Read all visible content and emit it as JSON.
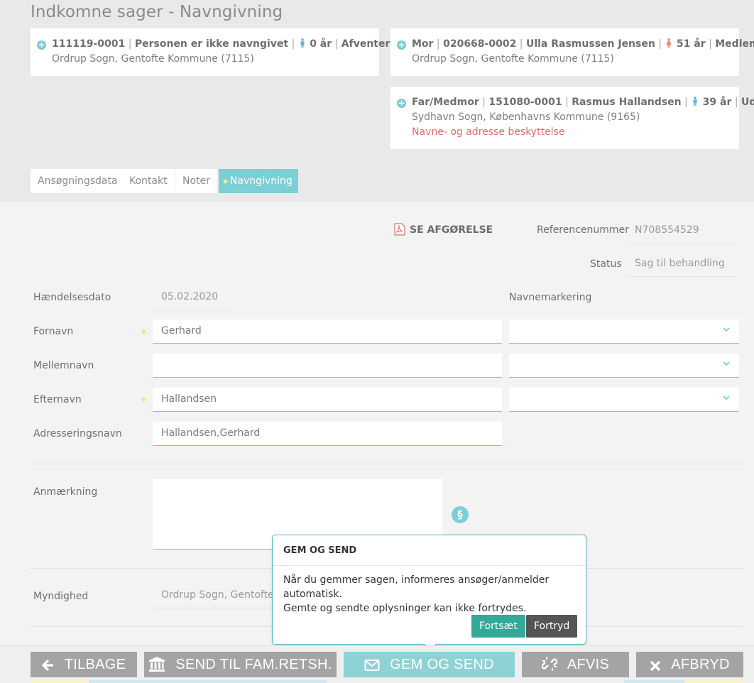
{
  "page": {
    "title": "Indkomne sager - Navngivning"
  },
  "cards": {
    "child": {
      "id": "111119-0001",
      "name": "Personen er ikke navngivet",
      "age": "0 år",
      "status": "Afventer",
      "location": "Ordrup Sogn, Gentofte Kommune (7115)"
    },
    "mother": {
      "role": "Mor",
      "id": "020668-0002",
      "name": "Ulla Rasmussen Jensen",
      "age": "51 år",
      "status": "Medlem",
      "location": "Ordrup Sogn, Gentofte Kommune (7115)"
    },
    "father": {
      "role": "Far/Medmor",
      "id": "151080-0001",
      "name": "Rasmus Hallandsen",
      "age": "39 år",
      "status": "Udenfor",
      "location": "Sydhavn Sogn, Københavns Kommune (9165)",
      "warning": "Navne- og adresse beskyttelse"
    }
  },
  "tabs": [
    {
      "label": "Ansøgningsdata"
    },
    {
      "label": "Kontakt"
    },
    {
      "label": "Noter"
    },
    {
      "label": "Navngivning"
    }
  ],
  "form": {
    "se_afgorelse": "SE AFGØRELSE",
    "referencenummer_label": "Referencenummer",
    "referencenummer_value": "N708554529",
    "status_label": "Status",
    "status_value": "Sag til behandling",
    "haendelsesdato_label": "Hændelsesdato",
    "haendelsesdato_value": "05.02.2020",
    "navnemarkering_label": "Navnemarkering",
    "fornavn_label": "Fornavn",
    "fornavn_value": "Gerhard",
    "mellemnavn_label": "Mellemnavn",
    "mellemnavn_value": "",
    "efternavn_label": "Efternavn",
    "efternavn_value": "Hallandsen",
    "adresseringsnavn_label": "Adresseringsnavn",
    "adresseringsnavn_value": "Hallandsen,Gerhard",
    "anmaerkning_label": "Anmærkning",
    "paragraph_symbol": "§",
    "myndighed_label": "Myndighed",
    "myndighed_value": "Ordrup Sogn, Gentofte Ko"
  },
  "popup": {
    "title": "GEM OG SEND",
    "text_line1": "Når du gemmer sagen, informeres ansøger/anmelder automatisk.",
    "text_line2": "Gemte og sendte oplysninger kan ikke fortrydes.",
    "continue_label": "Fortsæt",
    "cancel_label": "Fortryd"
  },
  "actions": {
    "back": "TILBAGE",
    "send_fam": "SEND TIL FAM.RETSH.",
    "save_send": "GEM OG SEND",
    "reject": "AFVIS",
    "abort": "AFBRYD"
  },
  "colors": {
    "accent": "#7ccfd6",
    "warning": "#e06b6b",
    "continue": "#33a99a",
    "cancel": "#555555",
    "button_grey": "#a4a4a4"
  },
  "icons": {
    "expand": "plus-circle-icon",
    "male": "male-person-icon",
    "female": "female-person-icon",
    "pdf": "pdf-icon",
    "paragraph": "paragraph-icon",
    "chevron": "chevron-down-icon",
    "back": "arrow-left-icon",
    "bank": "bank-icon",
    "envelope": "envelope-icon",
    "unlink": "unlink-icon",
    "close": "close-icon"
  }
}
